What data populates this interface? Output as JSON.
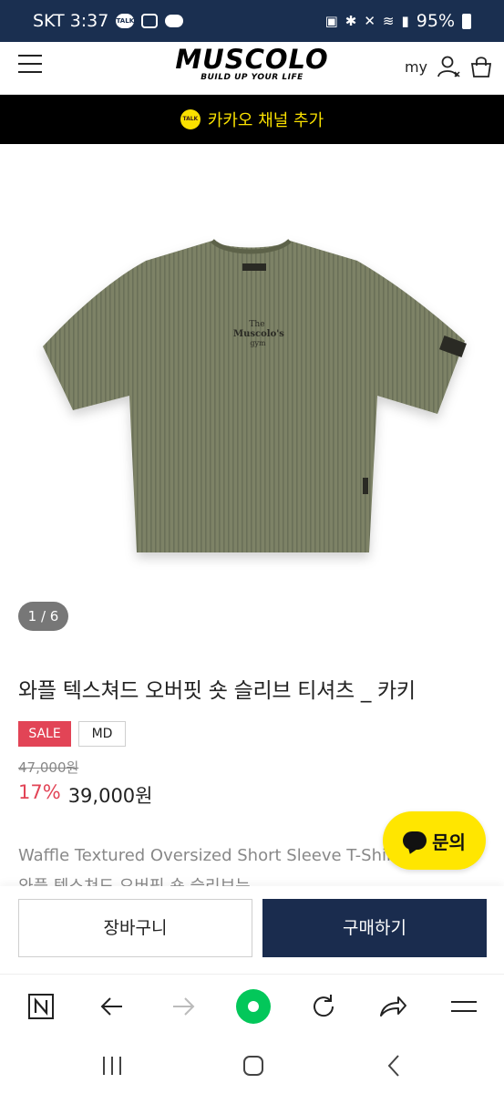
{
  "status_bar": {
    "carrier_time": "SKT 3:37",
    "talk_label": "TALK",
    "battery": "95%"
  },
  "header": {
    "logo": "MUSCOLO",
    "tagline": "BUILD UP YOUR LIFE",
    "my_label": "my"
  },
  "kakao_banner": {
    "label": "카카오 채널 추가",
    "icon_text": "TALK"
  },
  "product": {
    "image_counter": "1 / 6",
    "image_print": [
      "The",
      "Muscolo's",
      "gym"
    ],
    "title": "와플 텍스쳐드 오버핏 숏 슬리브 티셔츠 _ 카키",
    "badge_sale": "SALE",
    "badge_md": "MD",
    "original_price": "47,000원",
    "discount": "17%",
    "price": "39,000원",
    "desc_en": "Waffle Textured Oversized Short Sleeve T-Shirt",
    "desc_ko": "와플 텍스쳐드 오버핏 숏 슬리브는",
    "shirt_color": "#7d8266"
  },
  "inquiry_button": {
    "label": "문의"
  },
  "actions": {
    "cart_label": "장바구니",
    "buy_label": "구매하기"
  },
  "colors": {
    "status_bar": "#1a2f50",
    "accent_red": "#e24456",
    "buy_button": "#1a2c4e",
    "kakao_yellow": "#f9e000",
    "naver_green": "#03c75a"
  },
  "browser_toolbar": {
    "icons": [
      "naver-icon",
      "back-arrow-icon",
      "forward-arrow-icon",
      "green-dot-icon",
      "refresh-icon",
      "share-icon",
      "menu-icon"
    ]
  },
  "nav_bar": {
    "icons": [
      "recents-icon",
      "home-icon",
      "back-icon"
    ]
  }
}
